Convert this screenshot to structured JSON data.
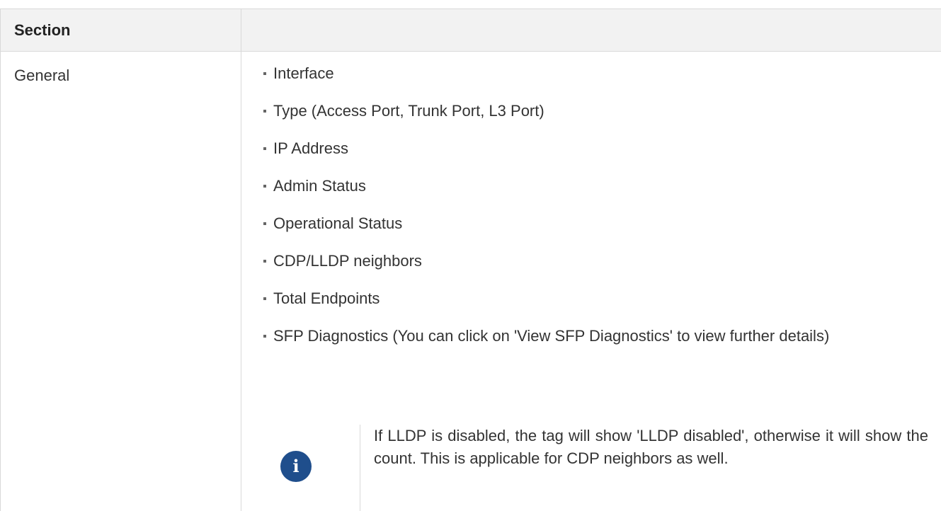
{
  "table": {
    "header": {
      "col1": "Section",
      "col2": ""
    },
    "rows": [
      {
        "section": "General",
        "items": [
          "Interface",
          "Type (Access Port, Trunk Port, L3 Port)",
          "IP Address",
          "Admin Status",
          "Operational Status",
          "CDP/LLDP neighbors",
          "Total Endpoints",
          "SFP Diagnostics (You can click on 'View SFP Diagnostics' to view further details)"
        ],
        "note": {
          "icon": "info-icon",
          "icon_glyph": "i",
          "text": "If LLDP is disabled, the tag will show 'LLDP disabled', otherwise it will show the count. This is applicable for CDP neighbors as well."
        }
      }
    ]
  },
  "colors": {
    "header_bg": "#f2f2f2",
    "border": "#d9d9d9",
    "info_icon_bg": "#1f4e8c"
  }
}
